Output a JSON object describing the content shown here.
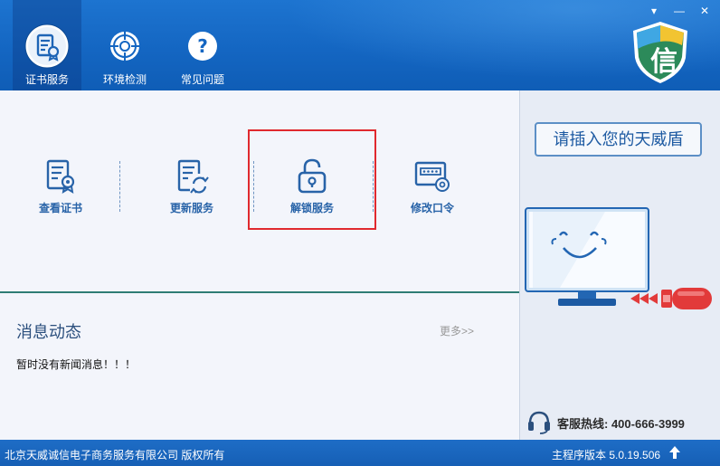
{
  "window": {
    "minimize_glyph": "—",
    "dropdown_glyph": "▾",
    "close_glyph": "✕"
  },
  "nav": {
    "items": [
      {
        "label": "证书服务",
        "icon": "certificate-icon",
        "active": true
      },
      {
        "label": "环境检测",
        "icon": "target-icon",
        "active": false
      },
      {
        "label": "常见问题",
        "icon": "question-icon",
        "active": false
      }
    ]
  },
  "brand": {
    "logo_text": "信"
  },
  "services": {
    "items": [
      {
        "label": "查看证书",
        "icon": "view-certificate-icon"
      },
      {
        "label": "更新服务",
        "icon": "update-document-icon"
      },
      {
        "label": "解锁服务",
        "icon": "unlock-icon",
        "highlighted": true
      },
      {
        "label": "修改口令",
        "icon": "change-password-icon"
      }
    ]
  },
  "news": {
    "title": "消息动态",
    "more": "更多>>",
    "empty": "暂时没有新闻消息！！！"
  },
  "right": {
    "insert_prompt": "请插入您的天威盾",
    "hotline": "客服热线: 400-666-3999"
  },
  "status": {
    "copyright": "北京天威诚信电子商务服务有限公司 版权所有",
    "version": "主程序版本 5.0.19.506"
  },
  "colors": {
    "header_blue": "#1466c2",
    "service_text": "#2863a8",
    "highlight_red": "#e0292e",
    "insert_text": "#1d5aa2"
  }
}
